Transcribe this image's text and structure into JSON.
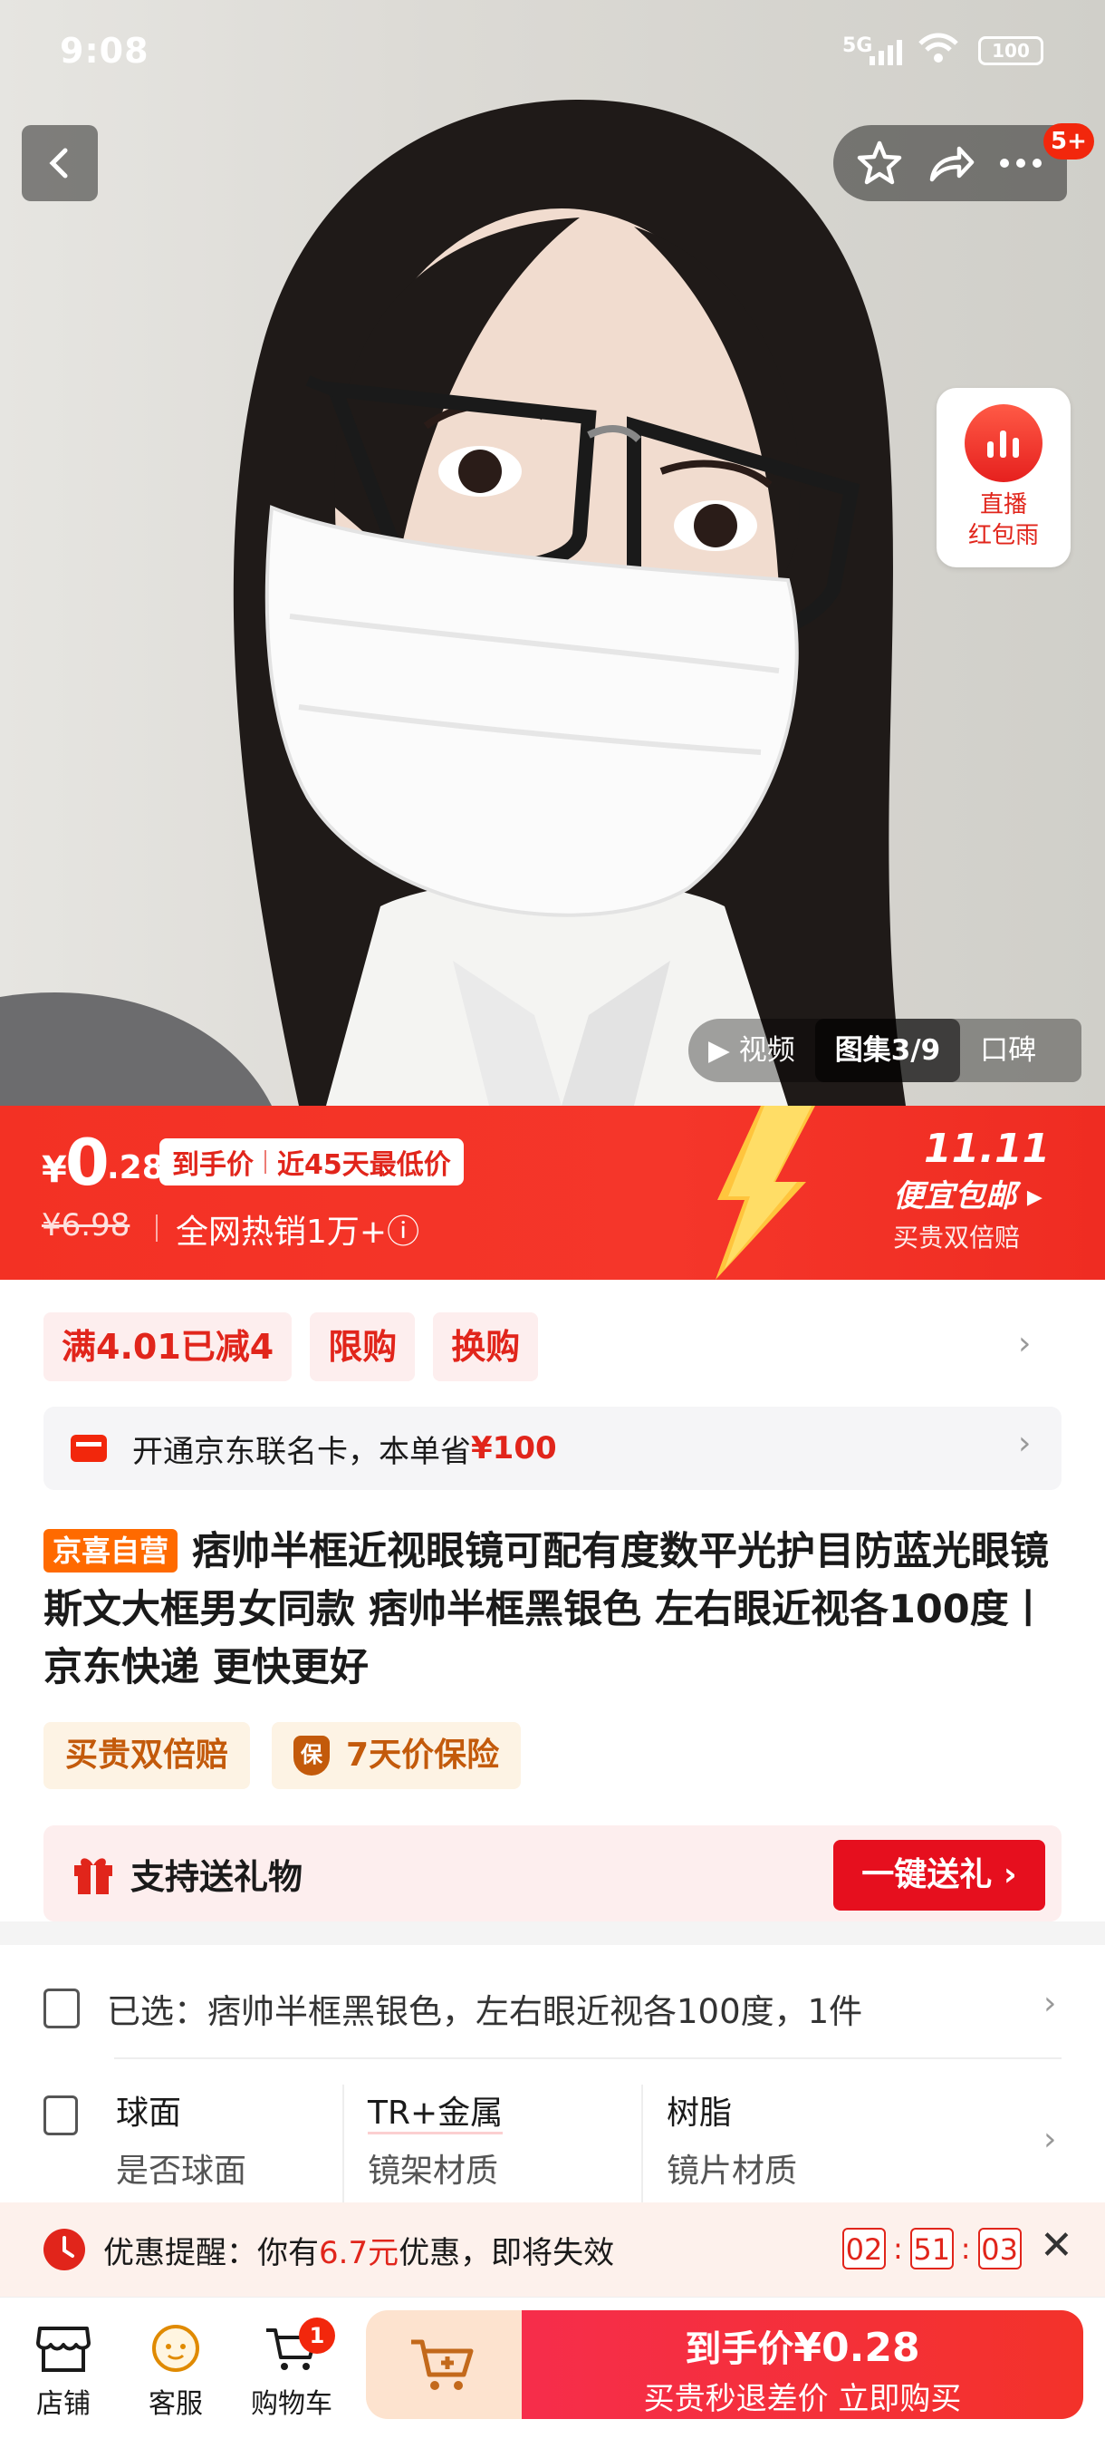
{
  "status_bar": {
    "time": "9:08",
    "network": "5G",
    "battery": "100"
  },
  "top_bar": {
    "more_badge": "5+"
  },
  "live_widget": {
    "line1": "直播",
    "line2": "红包雨"
  },
  "media_tabs": {
    "video": "视频",
    "gallery": "图集3/9",
    "reviews": "口碑"
  },
  "price_banner": {
    "currency": "¥",
    "price_int": "0",
    "price_dec": ".28",
    "tag_left": "到手价",
    "tag_right": "近45天最低价",
    "original_price": "¥6.98",
    "hot_sales": "全网热销1万+",
    "promo_logo": "11.11",
    "promo_title": "便宜包邮",
    "promo_sub": "买贵双倍赔"
  },
  "promo_chips": [
    "满4.01已减4",
    "限购",
    "换购"
  ],
  "card_offer": {
    "text": "开通京东联名卡，本单省",
    "amount": "¥100"
  },
  "product": {
    "badge": "京喜自营",
    "title": "痞帅半框近视眼镜可配有度数平光护目防蓝光眼镜斯文大框男女同款 痞帅半框黑银色 左右眼近视各100度丨京东快递 更快更好"
  },
  "guarantees": {
    "double_pay": "买贵双倍赔",
    "shield_char": "保",
    "price_insurance": "7天价保险"
  },
  "gift": {
    "label": "支持送礼物",
    "button": "一键送礼"
  },
  "selection": {
    "text": "已选：痞帅半框黑银色，左右眼近视各100度，1件"
  },
  "specs": [
    {
      "value": "球面",
      "label": "是否球面"
    },
    {
      "value": "TR+金属",
      "label": "镜架材质"
    },
    {
      "value": "树脂",
      "label": "镜片材质"
    }
  ],
  "reminder": {
    "prefix": "优惠提醒：你有",
    "amount": "6.7元",
    "suffix": "优惠，即将失效",
    "hh": "02",
    "mm": "51",
    "ss": "03"
  },
  "bottom_nav": {
    "store": "店铺",
    "service": "客服",
    "cart": "购物车",
    "cart_count": "1",
    "buy_line1_prefix": "到手价",
    "buy_line1_price": "¥0.28",
    "buy_line2": "买贵秒退差价 立即购买"
  },
  "colors": {
    "brand_red": "#e1251b",
    "banner_red": "#f33124",
    "orange": "#ff6a00"
  }
}
